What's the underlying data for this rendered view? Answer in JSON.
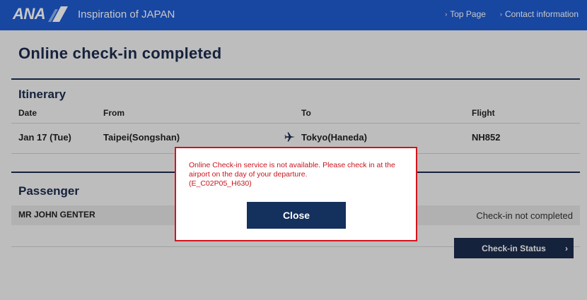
{
  "header": {
    "logo_text": "ANA",
    "tagline": "Inspiration of JAPAN",
    "nav": [
      {
        "label": "Top Page"
      },
      {
        "label": "Contact information"
      }
    ],
    "brand_color": "#1f5bd0"
  },
  "page": {
    "title": "Online check-in completed"
  },
  "itinerary": {
    "title": "Itinerary",
    "columns": [
      "Date",
      "From",
      "To",
      "Flight"
    ],
    "row": {
      "date": "Jan 17 (Tue)",
      "from": "Taipei(Songshan)",
      "to": "Tokyo(Haneda)",
      "flight": "NH852",
      "icon": "airplane-icon"
    }
  },
  "passenger": {
    "title": "Passenger",
    "name": "MR JOHN GENTER",
    "status": "Check-in not completed"
  },
  "status_button": {
    "label": "Check-in Status"
  },
  "modal": {
    "message": "Online Check-in service is not available. Please check in at the airport on the day of your departure.",
    "code": "(E_C02P05_H630)",
    "close_label": "Close",
    "error_color": "#d4141c"
  }
}
